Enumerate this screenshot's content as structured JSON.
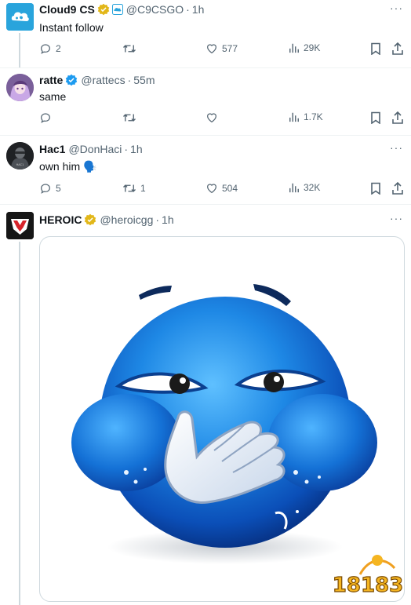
{
  "tweets": [
    {
      "name": "Cloud9 CS",
      "handle": "@C9CSGO",
      "time": "1h",
      "text": "Instant follow",
      "replies": "2",
      "reposts": "",
      "likes": "577",
      "views": "29K",
      "avatar_icon": "cloud9-logo-icon"
    },
    {
      "name": "ratte",
      "handle": "@rattecs",
      "time": "55m",
      "text": "same",
      "replies": "",
      "reposts": "",
      "likes": "",
      "views": "1.7K",
      "avatar_icon": "anime-avatar"
    },
    {
      "name": "Hac1",
      "handle": "@DonHaci",
      "time": "1h",
      "text": "own him 🗣️",
      "replies": "5",
      "reposts": "1",
      "likes": "504",
      "views": "32K",
      "avatar_icon": "soldier-avatar"
    },
    {
      "name": "HEROIC",
      "handle": "@heroicgg",
      "time": "1h",
      "avatar_icon": "heroic-logo-icon",
      "media": "blue-emoji-hand-over-mouth-image"
    }
  ],
  "dot": "·",
  "more": "···",
  "watermark": "18183",
  "colors": {
    "verified_gold": "#e2b719",
    "verified_blue": "#1d9bf0",
    "muted": "#536471",
    "thread_line": "#cfd9de"
  }
}
